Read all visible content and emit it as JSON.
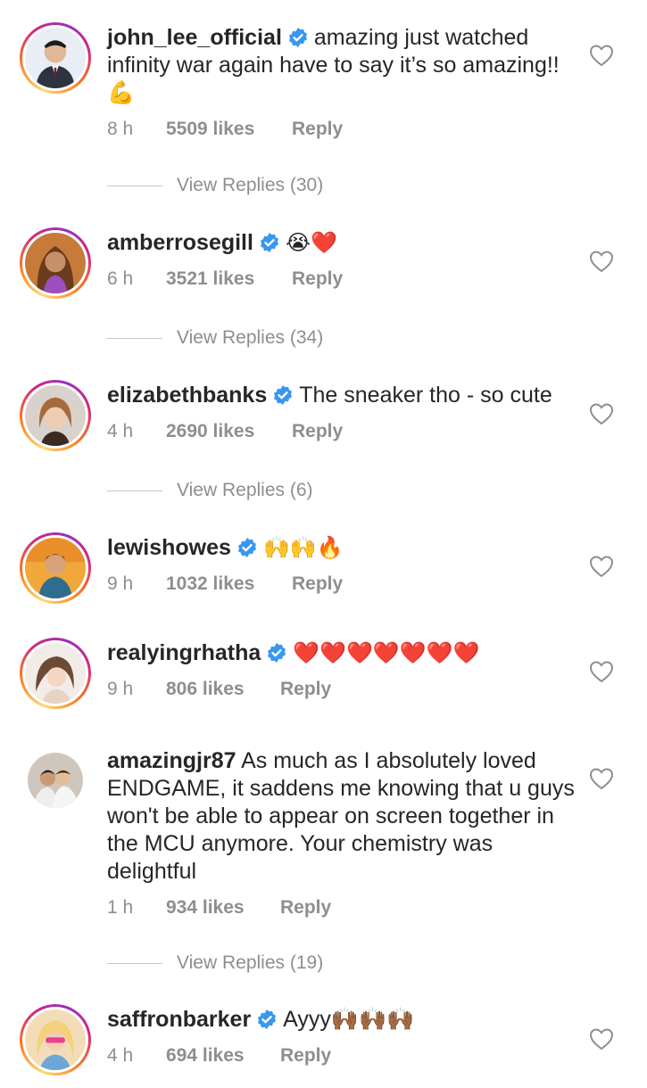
{
  "comments": [
    {
      "username": "john_lee_official",
      "verified": true,
      "text": "amazing just watched infinity war again have to say it’s so amazing!! 💪",
      "time": "8 h",
      "likes": "5509 likes",
      "reply": "Reply",
      "view_replies": "View Replies (30)"
    },
    {
      "username": "amberrosegill",
      "verified": true,
      "text": "😭❤️",
      "time": "6 h",
      "likes": "3521 likes",
      "reply": "Reply",
      "view_replies": "View Replies (34)"
    },
    {
      "username": "elizabethbanks",
      "verified": true,
      "text": "The sneaker tho - so cute",
      "time": "4 h",
      "likes": "2690 likes",
      "reply": "Reply",
      "view_replies": "View Replies (6)"
    },
    {
      "username": "lewishowes",
      "verified": true,
      "text": "🙌🙌🔥",
      "time": "9 h",
      "likes": "1032 likes",
      "reply": "Reply"
    },
    {
      "username": "realyingrhatha",
      "verified": true,
      "text": "❤️❤️❤️❤️❤️❤️❤️",
      "time": "9 h",
      "likes": "806 likes",
      "reply": "Reply"
    },
    {
      "username": "amazingjr87",
      "verified": false,
      "text": "As much as I absolutely loved ENDGAME, it saddens me knowing that u guys won't be able to appear on screen together in the MCU anymore. Your chemistry was delightful",
      "time": "1 h",
      "likes": "934 likes",
      "reply": "Reply",
      "view_replies": "View Replies (19)"
    },
    {
      "username": "saffronbarker",
      "verified": true,
      "text": "Ayyy🙌🏾🙌🏾🙌🏾",
      "time": "4 h",
      "likes": "694 likes",
      "reply": "Reply"
    }
  ],
  "colors": {
    "verified": "#3897f0",
    "muted": "#8e8e8e",
    "text": "#262626"
  }
}
